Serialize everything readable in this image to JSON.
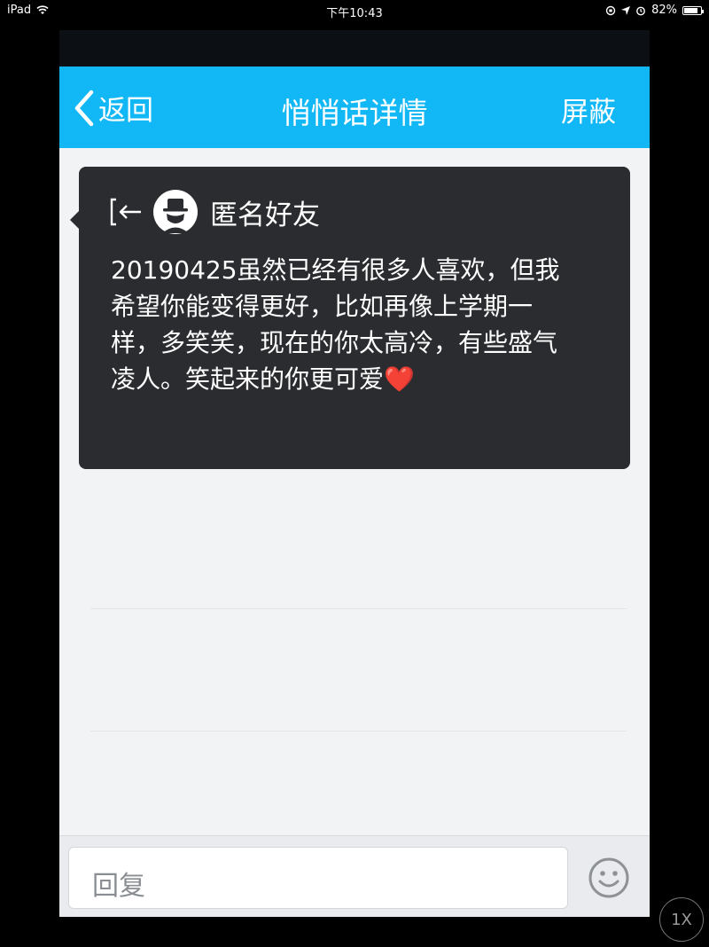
{
  "device_status": {
    "device": "iPad",
    "time": "下午10:43",
    "battery": "82%",
    "battery_fraction": 0.82
  },
  "navbar": {
    "back_label": "返回",
    "title": "悄悄话详情",
    "right_action": "屏蔽"
  },
  "message_card": {
    "sender": "匿名好友",
    "text": "20190425虽然已经有很多人喜欢，但我希望你能变得更好，比如再像上学期一样，多笑笑，现在的你太高冷，有些盛气凌人。笑起来的你更可爱",
    "emoji": "❤️"
  },
  "reply_bar": {
    "placeholder": "回复"
  },
  "overlay": {
    "speed_label": "1X"
  },
  "colors": {
    "navbar": "#12b7f5",
    "card": "#2a2c30",
    "background": "#f2f3f5"
  },
  "icons": [
    "wifi-icon",
    "orientation-lock-icon",
    "location-icon",
    "alarm-icon",
    "battery-icon",
    "back-chevron-icon",
    "exit-icon",
    "anonymous-avatar-icon",
    "emoji-icon"
  ]
}
